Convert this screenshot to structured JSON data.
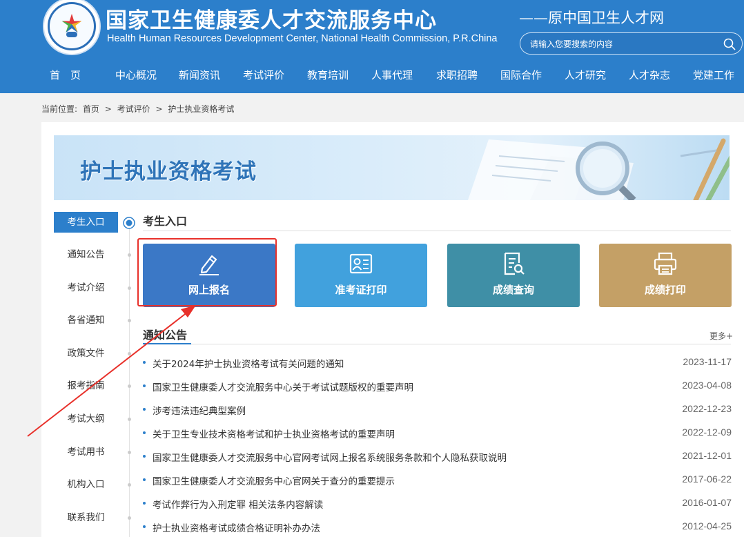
{
  "header": {
    "title_cn": "国家卫生健康委人才交流服务中心",
    "title_en": "Health Human Resources Development Center, National Health Commission, P.R.China",
    "subtitle": "——原中国卫生人才网",
    "search_placeholder": "请输入您要搜索的内容",
    "colors": {
      "brand": "#2c7fcb",
      "highlight": "#e8302a"
    }
  },
  "nav": {
    "items": [
      {
        "label": "首　页"
      },
      {
        "label": "中心概况"
      },
      {
        "label": "新闻资讯"
      },
      {
        "label": "考试评价"
      },
      {
        "label": "教育培训"
      },
      {
        "label": "人事代理"
      },
      {
        "label": "求职招聘"
      },
      {
        "label": "国际合作"
      },
      {
        "label": "人才研究"
      },
      {
        "label": "人才杂志"
      },
      {
        "label": "党建工作"
      }
    ]
  },
  "breadcrumb": {
    "prefix": "当前位置:",
    "items": [
      "首页",
      ">",
      "考试评价",
      ">",
      "护士执业资格考试"
    ]
  },
  "banner": {
    "title": "护士执业资格考试"
  },
  "sidebar": {
    "items": [
      {
        "label": "考生入口",
        "active": true
      },
      {
        "label": "通知公告"
      },
      {
        "label": "考试介绍"
      },
      {
        "label": "各省通知"
      },
      {
        "label": "政策文件"
      },
      {
        "label": "报考指南"
      },
      {
        "label": "考试大纲"
      },
      {
        "label": "考试用书"
      },
      {
        "label": "机构入口"
      },
      {
        "label": "联系我们"
      }
    ]
  },
  "entry": {
    "heading": "考生入口",
    "tiles": [
      {
        "label": "网上报名",
        "icon": "pencil-icon",
        "color": "#3b78c6"
      },
      {
        "label": "准考证打印",
        "icon": "id-card-icon",
        "color": "#41a1dd"
      },
      {
        "label": "成绩查询",
        "icon": "document-search-icon",
        "color": "#3f8fa6"
      },
      {
        "label": "成绩打印",
        "icon": "printer-icon",
        "color": "#c4a066"
      }
    ]
  },
  "notices": {
    "heading": "通知公告",
    "more": "更多+",
    "items": [
      {
        "title": "关于2024年护士执业资格考试有关问题的通知",
        "date": "2023-11-17"
      },
      {
        "title": "国家卫生健康委人才交流服务中心关于考试试题版权的重要声明",
        "date": "2023-04-08"
      },
      {
        "title": "涉考违法违纪典型案例",
        "date": "2022-12-23"
      },
      {
        "title": "关于卫生专业技术资格考试和护士执业资格考试的重要声明",
        "date": "2022-12-09"
      },
      {
        "title": "国家卫生健康委人才交流服务中心官网考试网上报名系统服务条款和个人隐私获取说明",
        "date": "2021-12-01"
      },
      {
        "title": "国家卫生健康委人才交流服务中心官网关于查分的重要提示",
        "date": "2017-06-22"
      },
      {
        "title": "考试作弊行为入刑定罪 相关法条内容解读",
        "date": "2016-01-07"
      },
      {
        "title": "护士执业资格考试成绩合格证明补办办法",
        "date": "2012-04-25"
      }
    ]
  }
}
